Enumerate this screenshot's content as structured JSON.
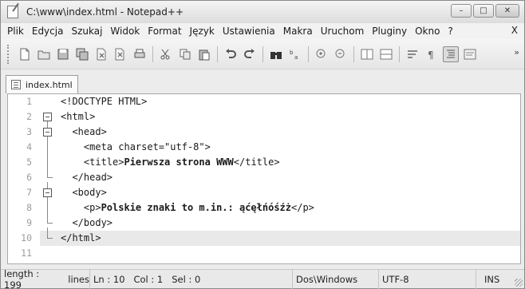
{
  "window": {
    "title": "C:\\www\\index.html - Notepad++",
    "controls": {
      "minimize": "–",
      "maximize": "□",
      "close": "✕"
    }
  },
  "menu": {
    "items": [
      "Plik",
      "Edycja",
      "Szukaj",
      "Widok",
      "Format",
      "Język",
      "Ustawienia",
      "Makra",
      "Uruchom",
      "Pluginy",
      "Okno",
      "?"
    ],
    "close": "X"
  },
  "toolbar": {
    "more": "»",
    "icons": [
      "new-file-icon",
      "open-file-icon",
      "save-icon",
      "save-all-icon",
      "close-icon",
      "close-all-icon",
      "print-icon",
      "cut-icon",
      "copy-icon",
      "paste-icon",
      "undo-icon",
      "redo-icon",
      "find-icon",
      "replace-icon",
      "zoom-in-icon",
      "zoom-out-icon",
      "sync-vertical-icon",
      "sync-horizontal-icon",
      "word-wrap-icon",
      "show-all-chars-icon",
      "indent-guide-icon",
      "language-icon"
    ]
  },
  "tab": {
    "label": "index.html"
  },
  "editor": {
    "active_line": 10,
    "lines": [
      {
        "num": "1",
        "text": "<!DOCTYPE HTML>"
      },
      {
        "num": "2",
        "text": "<html>"
      },
      {
        "num": "3",
        "text": "  <head>"
      },
      {
        "num": "4",
        "text": "    <meta charset=\"utf-8\">"
      },
      {
        "num": "5",
        "pre": "    <title>",
        "bold": "Pierwsza strona WWW",
        "post": "</title>"
      },
      {
        "num": "6",
        "text": "  </head>"
      },
      {
        "num": "7",
        "text": "  <body>"
      },
      {
        "num": "8",
        "pre": "    <p>",
        "bold": "Polskie znaki to m.in.: ąćęłńóśźż",
        "post": "</p>"
      },
      {
        "num": "9",
        "text": "  </body>"
      },
      {
        "num": "10",
        "text": "</html>"
      },
      {
        "num": "11",
        "text": ""
      }
    ]
  },
  "status": {
    "length": "length : 199",
    "lines": "lines",
    "ln": "Ln : 10",
    "col": "Col : 1",
    "sel": "Sel : 0",
    "eol": "Dos\\Windows",
    "encoding": "UTF-8",
    "mode": "INS"
  }
}
